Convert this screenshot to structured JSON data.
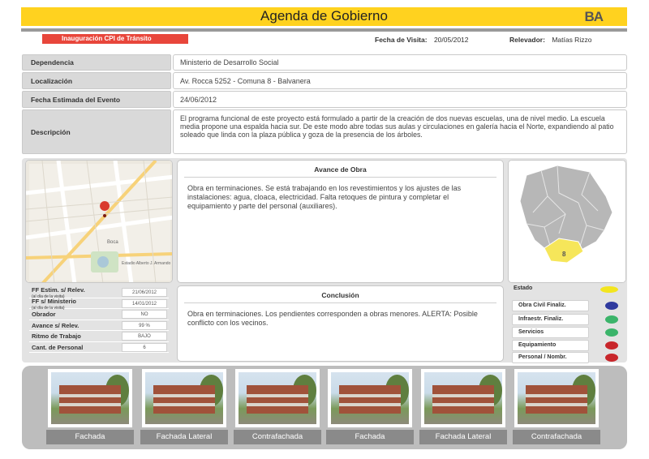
{
  "header": {
    "title": "Agenda de Gobierno",
    "logo": "BA"
  },
  "subheader": {
    "tab_label": "Inauguración CPI de Tránsito",
    "fecha_visita_label": "Fecha de Visita:",
    "fecha_visita_value": "20/05/2012",
    "relevador_label": "Relevador:",
    "relevador_value": "Matías Rizzo"
  },
  "fields": {
    "dependencia": {
      "label": "Dependencia",
      "value": "Ministerio de Desarrollo Social"
    },
    "localizacion": {
      "label": "Localización",
      "value": "Av. Rocca 5252 - Comuna 8 - Balvanera"
    },
    "fecha_estimada": {
      "label": "Fecha Estimada del Evento",
      "value": "24/06/2012"
    },
    "descripcion": {
      "label": "Descripción",
      "value": "El programa funcional de este proyecto está formulado a partir de la creación de dos nuevas escuelas, una de nivel medio. La escuela media propone una espalda hacia sur. De este modo abre todas sus aulas y circulaciones en galería hacia el Norte, expandiendo al patio soleado que linda con la plaza pública y goza de la presencia de los árboles."
    }
  },
  "map": {
    "place_label": "Estadio Alberto J. Armando",
    "street_label": "Boca"
  },
  "avance": {
    "title": "Avance de Obra",
    "text": "Obra en terminaciones. Se está trabajando en los revestimientos y los ajustes de las instalaciones: agua, cloaca, electricidad. Falta retoques de pintura y completar el equipamiento y parte del personal (auxiliares)."
  },
  "comuna": {
    "number": "8"
  },
  "conclusion": {
    "title": "Conclusión",
    "text": "Obra en terminaciones. Los pendientes corresponden a obras menores. ALERTA: Posible conflicto con los vecinos."
  },
  "ff_table": [
    {
      "label": "FF Estim. s/ Relev.",
      "sub": "(al día de la visita)",
      "value": "21/06/2012"
    },
    {
      "label": "FF s/ Ministerio",
      "sub": "(al día de la visita)",
      "value": "14/01/2012"
    },
    {
      "label": "Obrador",
      "sub": "",
      "value": "NO"
    },
    {
      "label": "Avance s/ Relev.",
      "sub": "",
      "value": "99 %"
    },
    {
      "label": "Ritmo de Trabajo",
      "sub": "",
      "value": "BAJO"
    },
    {
      "label": "Cant. de Personal",
      "sub": "",
      "value": "6"
    }
  ],
  "estado": [
    {
      "label": "Estado",
      "color": "#f3e51f"
    },
    {
      "label": "Obra Civil Finaliz.",
      "color": "#2f3a9e"
    },
    {
      "label": "Infraestr. Finaliz.",
      "color": "#3bb46a"
    },
    {
      "label": "Servicios",
      "color": "#3bb46a"
    },
    {
      "label": "Equipamiento",
      "color": "#c8262b"
    },
    {
      "label": "Personal / Nombr.",
      "color": "#c8262b"
    }
  ],
  "photos": [
    {
      "caption": "Fachada"
    },
    {
      "caption": "Fachada Lateral"
    },
    {
      "caption": "Contrafachada"
    },
    {
      "caption": "Fachada"
    },
    {
      "caption": "Fachada Lateral"
    },
    {
      "caption": "Contrafachada"
    }
  ]
}
